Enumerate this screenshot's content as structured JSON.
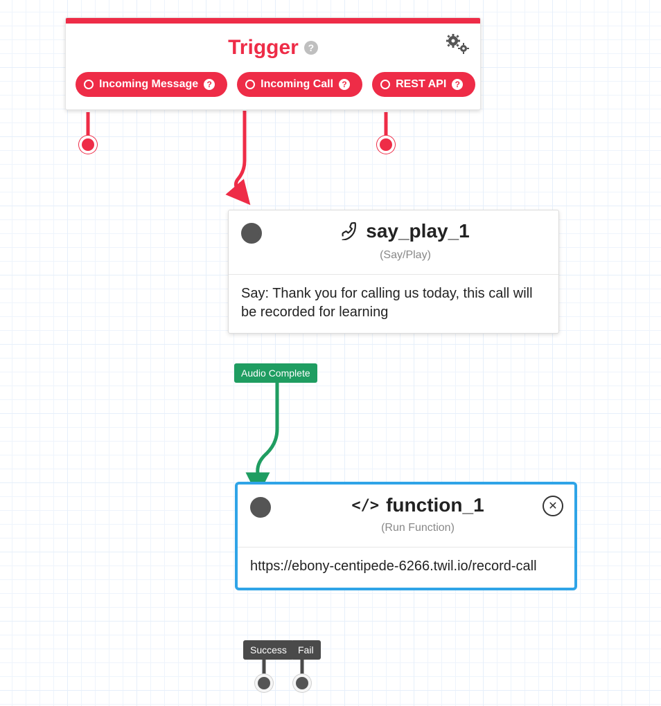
{
  "trigger": {
    "title": "Trigger",
    "pills": [
      {
        "label": "Incoming Message"
      },
      {
        "label": "Incoming Call"
      },
      {
        "label": "REST API"
      }
    ]
  },
  "sayplay": {
    "name": "say_play_1",
    "subtitle": "(Say/Play)",
    "body_prefix": "Say: ",
    "body": "Thank you for calling us today, this call will be recorded for learning",
    "outcome": "Audio Complete"
  },
  "func": {
    "name": "function_1",
    "subtitle": "(Run Function)",
    "url": "https://ebony-centipede-6266.twil.io/record-call",
    "outcomes": [
      "Success",
      "Fail"
    ]
  },
  "colors": {
    "accent": "#ee2c47",
    "green": "#1f9d61",
    "blue": "#2fa4e7",
    "gray": "#4a4a4a"
  }
}
